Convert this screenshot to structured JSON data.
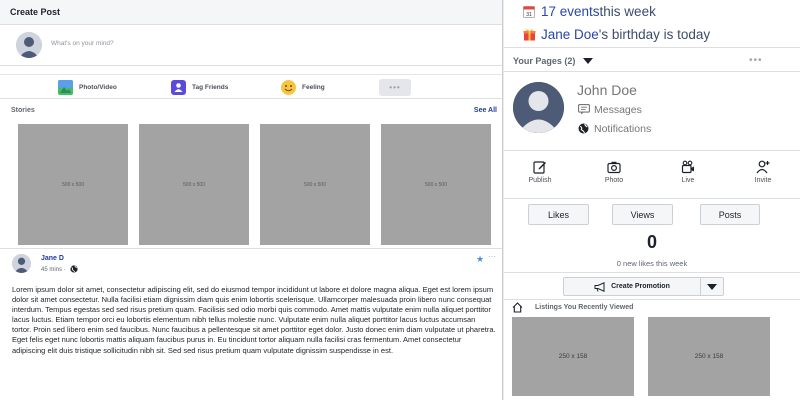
{
  "create_post": {
    "title": "Create Post",
    "placeholder": "What's on your mind?",
    "actions": [
      {
        "label": "Photo/Video",
        "icon": "photo-icon"
      },
      {
        "label": "Tag Friends",
        "icon": "tag-friends-icon"
      },
      {
        "label": "Feeling",
        "icon": "smiley-icon"
      }
    ],
    "more": "•••"
  },
  "stories": {
    "title": "Stories",
    "see_all": "See All",
    "items": [
      "500 x 500",
      "500 x 500",
      "500 x 500",
      "500 x 500"
    ]
  },
  "post": {
    "author": "Jane D",
    "time": "45 mins ·",
    "dots": "···",
    "text": "Lorem ipsum dolor sit amet, consectetur adipiscing elit, sed do eiusmod tempor incididunt ut labore et dolore magna aliqua. Eget est lorem ipsum dolor sit amet consectetur. Nulla facilisi etiam dignissim diam quis enim lobortis scelerisque. Ullamcorper malesuada proin libero nunc consequat interdum. Tempus egestas sed sed risus pretium quam. Facilisis sed odio morbi quis commodo. Amet mattis vulputate enim nulla aliquet porttitor lacus luctus. Etiam tempor orci eu lobortis elementum nibh tellus molestie nunc. Vulputate enim nulla aliquet porttitor lacus luctus accumsan tortor. Proin sed libero enim sed faucibus. Nunc faucibus a pellentesque sit amet porttitor eget dolor. Justo donec enim diam vulputate ut pharetra. Eget felis eget nunc lobortis mattis aliquam faucibus purus in. Eu tincidunt tortor aliquam nulla facilisi cras fermentum. Amet consectetur adipiscing elit duis tristique sollicitudin nibh sit. Sed sed risus pretium quam vulputate dignissim suspendisse in est."
  },
  "reminders": {
    "events_link": "17 events",
    "events_suffix": " this week",
    "birthday_name": "Jane Doe",
    "birthday_suffix": "'s birthday is today"
  },
  "your_pages": {
    "title": "Your Pages (2)",
    "dots": "•••",
    "page_name": "John Doe",
    "messages": "Messages",
    "notifications": "Notifications",
    "actions": [
      {
        "label": "Publish",
        "icon": "edit-icon"
      },
      {
        "label": "Photo",
        "icon": "camera-icon"
      },
      {
        "label": "Live",
        "icon": "live-video-icon"
      },
      {
        "label": "Invite",
        "icon": "add-user-icon"
      }
    ],
    "tabs": [
      "Likes",
      "Views",
      "Posts"
    ],
    "count": "0",
    "count_text": "0 new likes this week",
    "promotion": "Create Promotion",
    "listings_title": "Listings You Recently Viewed",
    "listings": [
      "250 x 158",
      "250 x 158"
    ]
  },
  "colors": {
    "link": "#2946a8",
    "placeholder_gray": "#a3a3a3",
    "divider": "#dddfe2"
  }
}
